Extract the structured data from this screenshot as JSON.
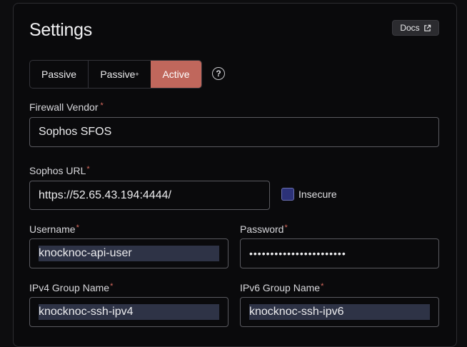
{
  "header": {
    "title": "Settings",
    "docs_label": "Docs",
    "docs_icon": "external-link-icon"
  },
  "mode": {
    "options": [
      {
        "label": "Passive"
      },
      {
        "label": "Passive",
        "suffix": "+"
      },
      {
        "label": "Active"
      }
    ],
    "selected": "Active",
    "help_icon": "question-circle-icon",
    "help_glyph": "?"
  },
  "form": {
    "vendor": {
      "label": "Firewall Vendor",
      "required_mark": "*",
      "value": "Sophos SFOS"
    },
    "url": {
      "label": "Sophos URL",
      "required_mark": "*",
      "value": "https://52.65.43.194:4444/"
    },
    "insecure": {
      "label": "Insecure",
      "checked": false
    },
    "username": {
      "label": "Username",
      "required_mark": "*",
      "value": "knocknoc-api-user"
    },
    "password": {
      "label": "Password",
      "required_mark": "*",
      "value": "•••••••••••••••••••••••"
    },
    "ipv4_group": {
      "label": "IPv4 Group Name",
      "required_mark": "*",
      "value": "knocknoc-ssh-ipv4"
    },
    "ipv6_group": {
      "label": "IPv6 Group Name",
      "required_mark": "*",
      "value": "knocknoc-ssh-ipv6"
    }
  },
  "colors": {
    "accent": "#c0675c",
    "checkbox": "#2c3278",
    "required": "#d96a5e"
  }
}
